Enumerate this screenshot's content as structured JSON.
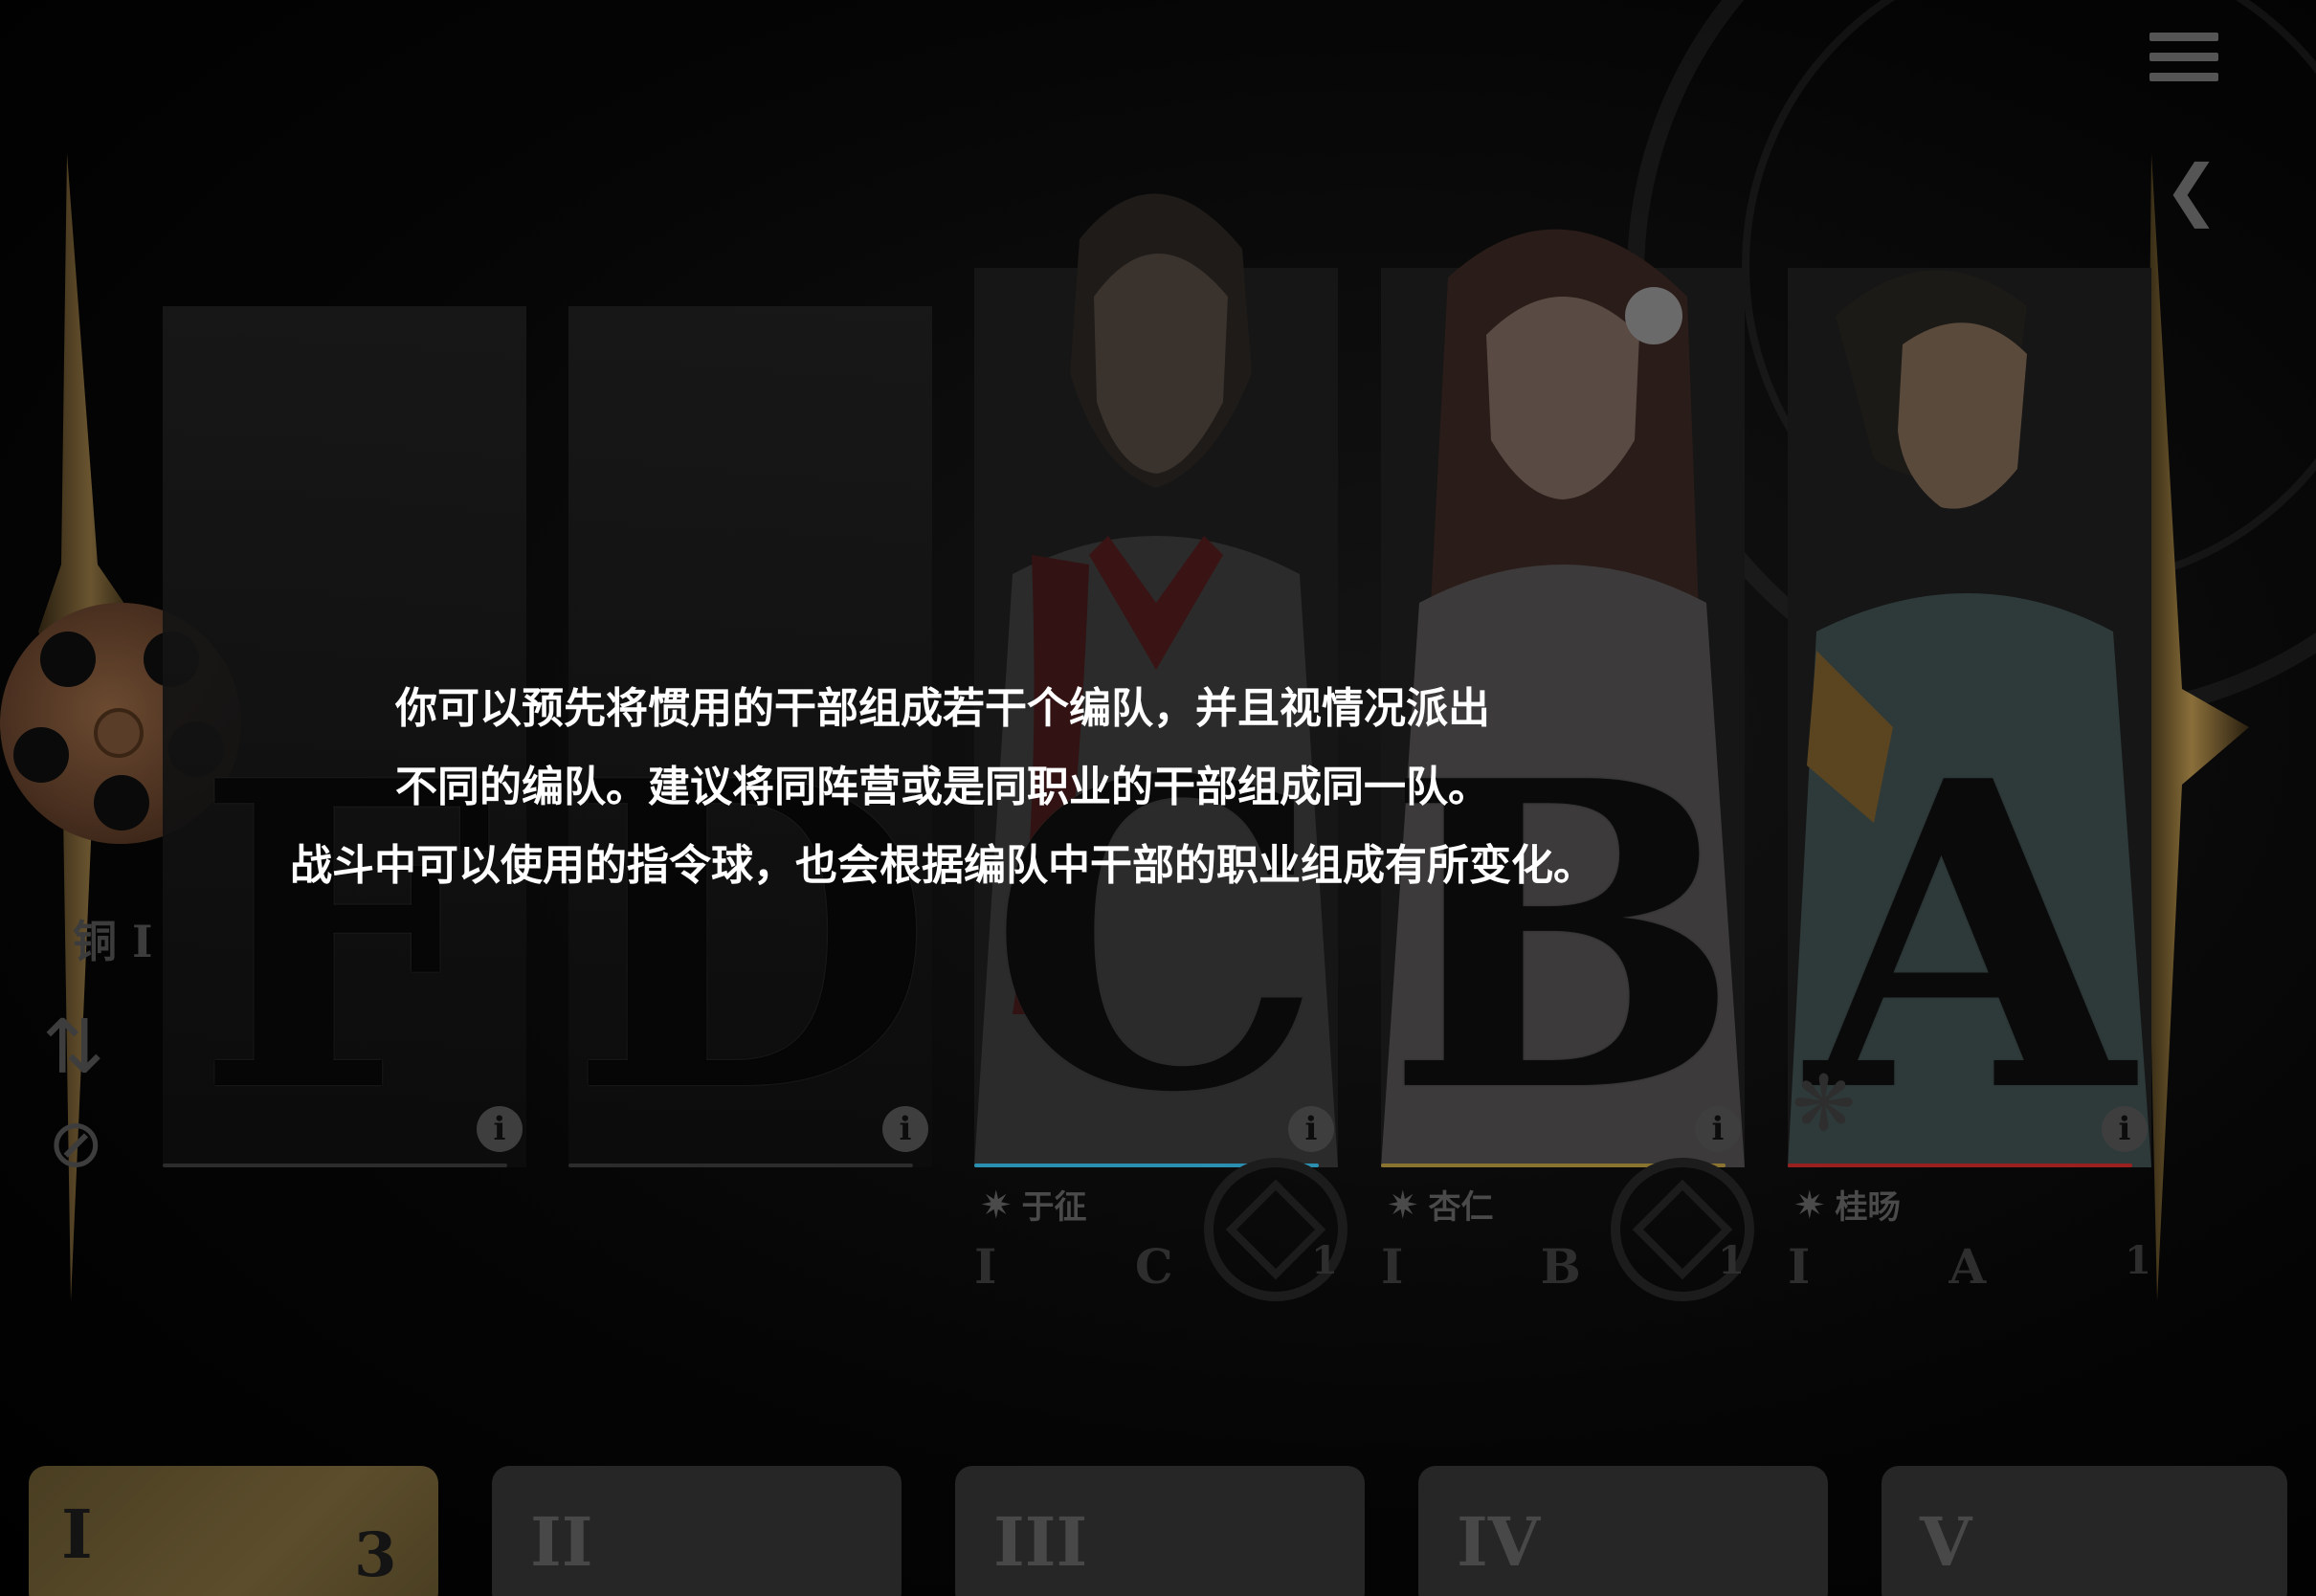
{
  "colors": {
    "accent_gold": "#8a6f3a",
    "active_tab": "#5c4e2c",
    "class_c_line": "#2a8fb0",
    "class_b_line": "#8a7430",
    "class_a_line": "#9a2020"
  },
  "header": {
    "menu_icon": "hamburger-menu-icon",
    "back_icon": "back-arrow-icon"
  },
  "sidebar": {
    "rank_label": "铜 I",
    "swap_icon": "swap-arrows-icon",
    "auto_icon": "auto-battle-disabled-icon"
  },
  "tip_lines": [
    "你可以预先将惯用的干部组成若干个编队，并且视情况派出",
    "不同的编队。建议将同阵营或是同职业的干部组成同一队。",
    "战斗中可以使用的指令球，也会根据编队中干部的职业组成有所变化。"
  ],
  "slots": [
    {
      "emblem": "F",
      "info": "i",
      "name": "",
      "rank": "",
      "class": "",
      "level": ""
    },
    {
      "emblem": "D",
      "info": "i",
      "name": "",
      "rank": "",
      "class": "",
      "level": ""
    },
    {
      "emblem": "C",
      "info": "i",
      "name": "于征",
      "rank": "I",
      "class": "C",
      "level": "1"
    },
    {
      "emblem": "B",
      "info": "i",
      "name": "杏仁",
      "rank": "I",
      "class": "B",
      "level": "1"
    },
    {
      "emblem": "A",
      "info": "i",
      "name": "桂旸",
      "rank": "I",
      "class": "A",
      "level": "1"
    }
  ],
  "team_tabs": [
    {
      "label": "I",
      "count": "3",
      "active": true
    },
    {
      "label": "II",
      "count": "",
      "active": false
    },
    {
      "label": "III",
      "count": "",
      "active": false
    },
    {
      "label": "IV",
      "count": "",
      "active": false
    },
    {
      "label": "V",
      "count": "",
      "active": false
    }
  ]
}
